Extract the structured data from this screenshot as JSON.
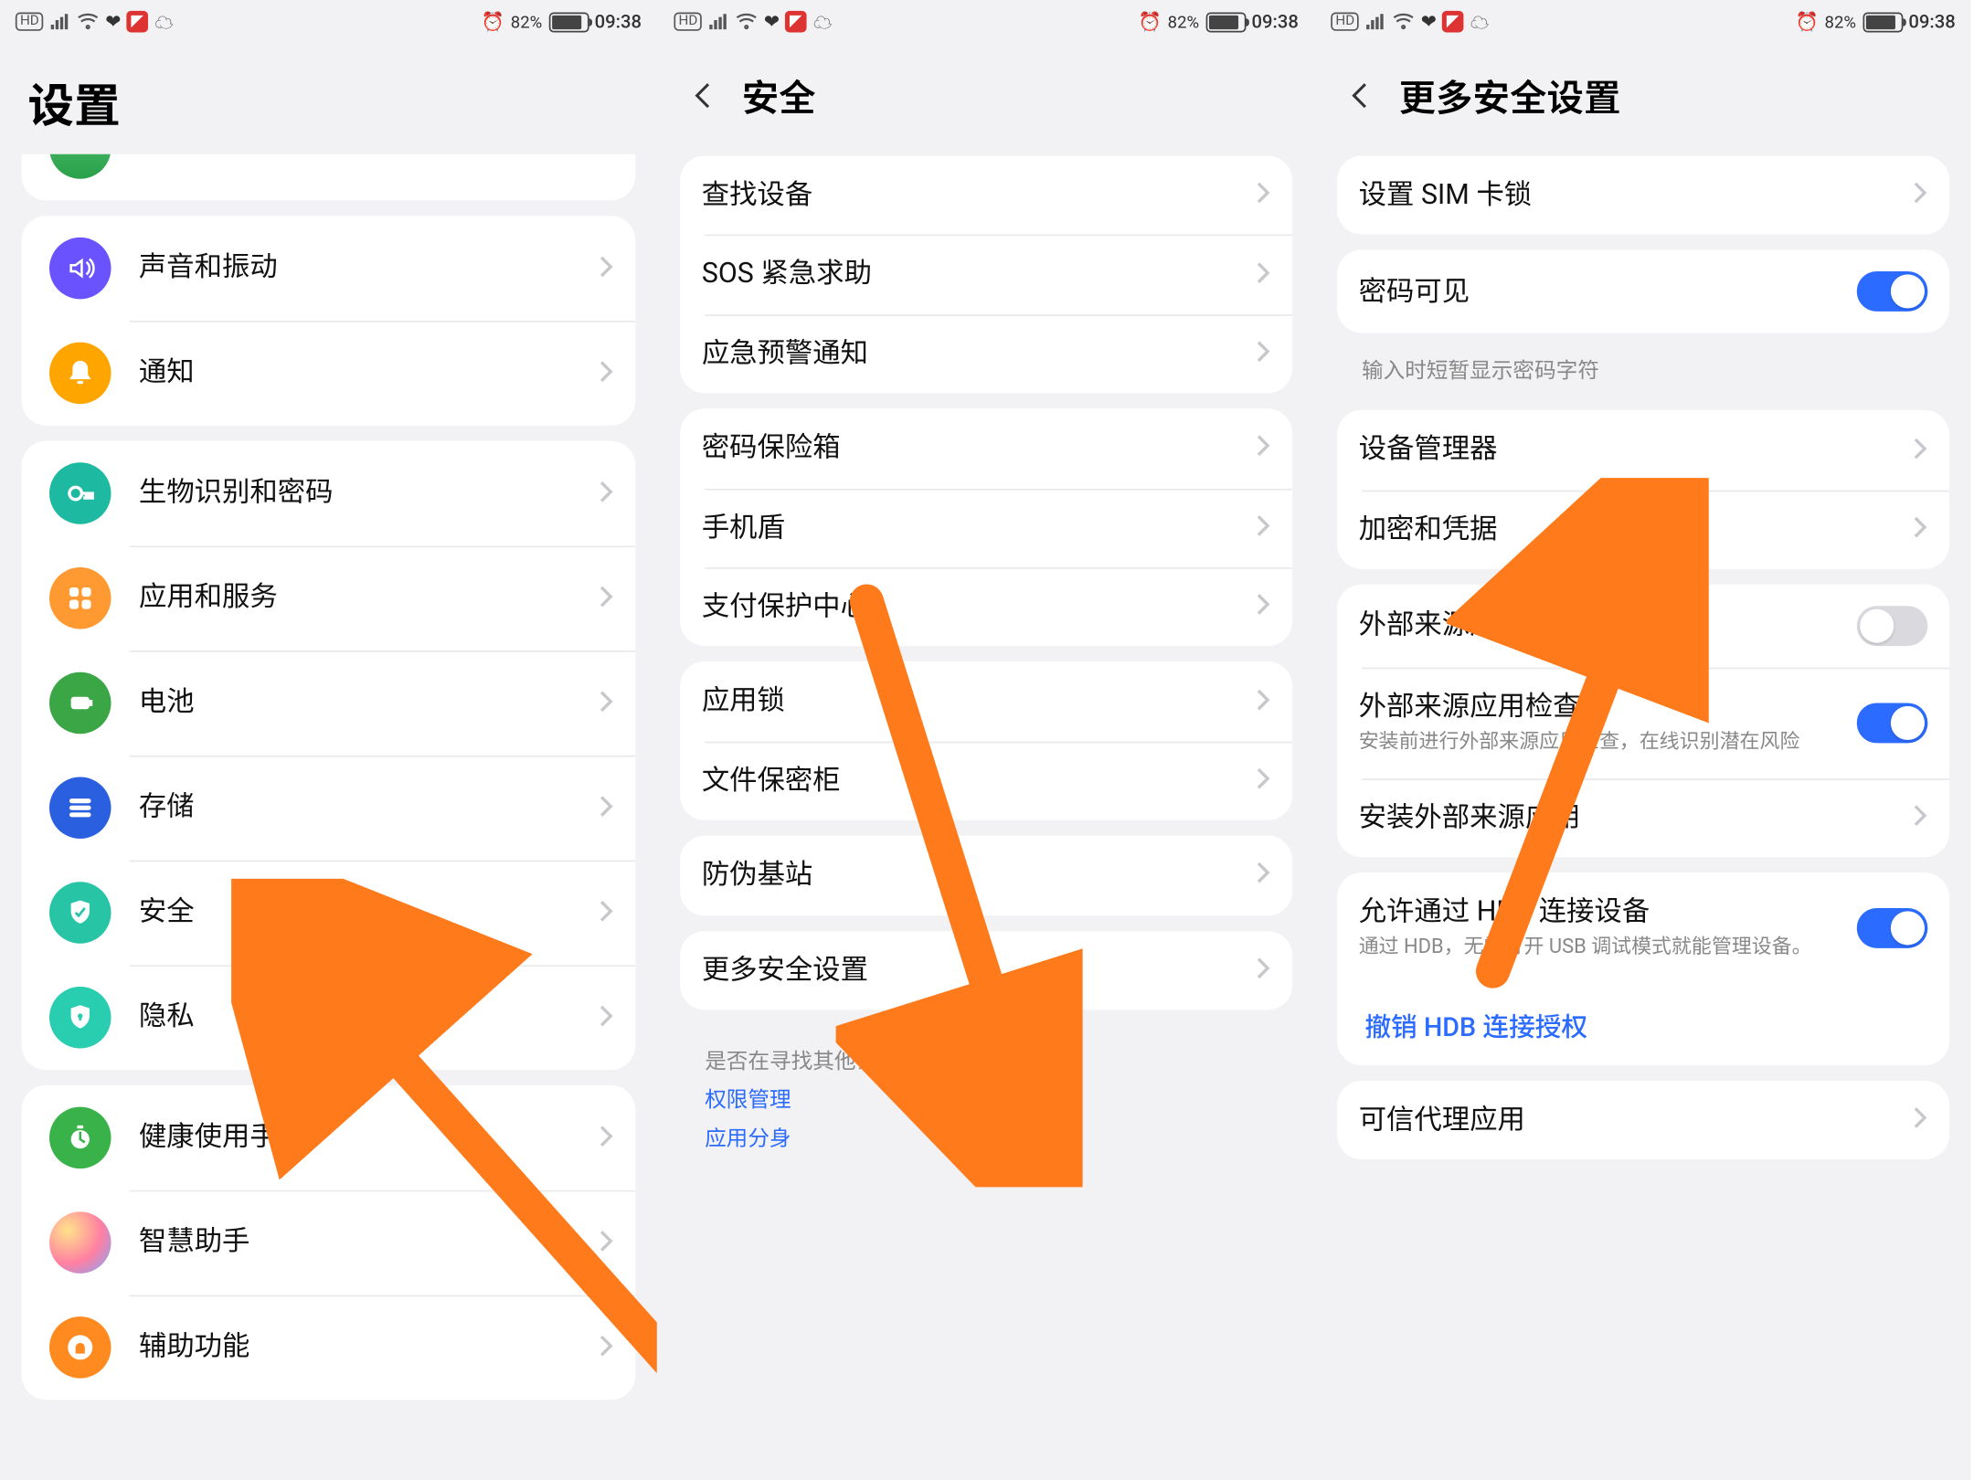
{
  "status": {
    "battery_pct": "82%",
    "time": "09:38"
  },
  "colors": {
    "accent": "#2b6bff",
    "arrow": "#ff7a1a"
  },
  "screen1": {
    "title": "设置",
    "groups": [
      {
        "items": [
          {
            "icon": "sound",
            "icon_color": "#6a53ff",
            "label": "声音和振动"
          },
          {
            "icon": "bell",
            "icon_color": "#ffa500",
            "label": "通知"
          }
        ]
      },
      {
        "items": [
          {
            "icon": "key",
            "icon_color": "#1db9a0",
            "label": "生物识别和密码"
          },
          {
            "icon": "grid",
            "icon_color": "#ff9a33",
            "label": "应用和服务"
          },
          {
            "icon": "batt",
            "icon_color": "#3aa646",
            "label": "电池"
          },
          {
            "icon": "store",
            "icon_color": "#2a5fe0",
            "label": "存储"
          },
          {
            "icon": "shield",
            "icon_color": "#28c4a6",
            "label": "安全"
          },
          {
            "icon": "lock",
            "icon_color": "#29cdb0",
            "label": "隐私"
          }
        ]
      },
      {
        "items": [
          {
            "icon": "timer",
            "icon_color": "#39b24a",
            "label": "健康使用手机"
          },
          {
            "icon": "orb",
            "icon_color": "gradient",
            "label": "智慧助手"
          },
          {
            "icon": "hand",
            "icon_color": "#ff8a1f",
            "label": "辅助功能"
          }
        ]
      }
    ]
  },
  "screen2": {
    "title": "安全",
    "groups": [
      {
        "items": [
          {
            "label": "查找设备"
          },
          {
            "label": "SOS 紧急求助"
          },
          {
            "label": "应急预警通知"
          }
        ]
      },
      {
        "items": [
          {
            "label": "密码保险箱"
          },
          {
            "label": "手机盾"
          },
          {
            "label": "支付保护中心"
          }
        ]
      },
      {
        "items": [
          {
            "label": "应用锁"
          },
          {
            "label": "文件保密柜"
          }
        ]
      },
      {
        "items": [
          {
            "label": "防伪基站"
          }
        ]
      },
      {
        "items": [
          {
            "label": "更多安全设置"
          }
        ]
      }
    ],
    "footer": {
      "question": "是否在寻找其他设置项?",
      "links": [
        "权限管理",
        "应用分身"
      ]
    }
  },
  "screen3": {
    "title": "更多安全设置",
    "sections": [
      {
        "kind": "group",
        "items": [
          {
            "type": "nav",
            "label": "设置 SIM 卡锁"
          }
        ]
      },
      {
        "kind": "group",
        "items": [
          {
            "type": "toggle",
            "label": "密码可见",
            "on": true
          }
        ]
      },
      {
        "kind": "hint",
        "text": "输入时短暂显示密码字符"
      },
      {
        "kind": "group",
        "items": [
          {
            "type": "nav",
            "label": "设备管理器"
          },
          {
            "type": "nav",
            "label": "加密和凭据"
          }
        ]
      },
      {
        "kind": "group",
        "items": [
          {
            "type": "toggle",
            "label": "外部来源应用下载",
            "on": false
          },
          {
            "type": "toggle",
            "label": "外部来源应用检查",
            "desc": "安装前进行外部来源应用检查，在线识别潜在风险",
            "on": true
          },
          {
            "type": "nav",
            "label": "安装外部来源应用"
          }
        ]
      },
      {
        "kind": "group",
        "items": [
          {
            "type": "toggle",
            "label": "允许通过 HDB 连接设备",
            "desc": "通过 HDB，无需打开 USB 调试模式就能管理设备。",
            "on": true
          },
          {
            "type": "link",
            "label": "撤销 HDB 连接授权"
          }
        ]
      },
      {
        "kind": "group",
        "items": [
          {
            "type": "nav",
            "label": "可信代理应用"
          }
        ]
      }
    ]
  }
}
